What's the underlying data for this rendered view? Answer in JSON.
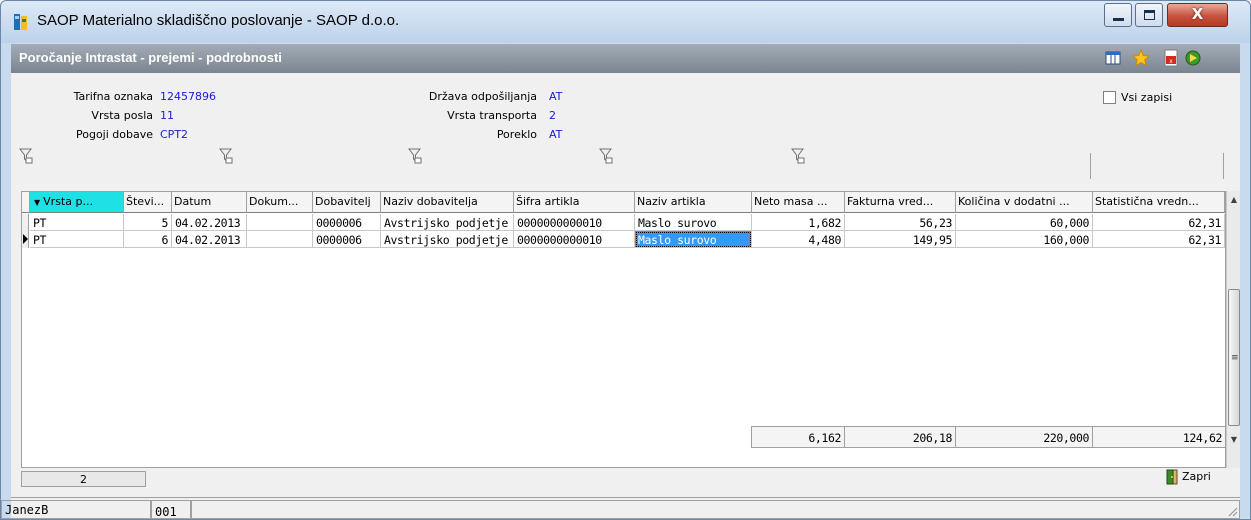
{
  "window": {
    "title": "SAOP Materialno skladiščno poslovanje - SAOP d.o.o.",
    "minimize": "—",
    "maximize": "□",
    "close": "X"
  },
  "form": {
    "title": "Poročanje Intrastat - prejemi - podrobnosti",
    "toolbar_icons": [
      "columns-icon",
      "favorite-star-icon",
      "export-pdf-icon",
      "exit-icon"
    ]
  },
  "filters": {
    "tarifna_oznaka_label": "Tarifna oznaka",
    "tarifna_oznaka": "12457896",
    "vrsta_posla_label": "Vrsta posla",
    "vrsta_posla": "11",
    "pogoji_dobave_label": "Pogoji dobave",
    "pogoji_dobave": "CPT2",
    "drzava_label": "Država odpošiljanja",
    "drzava": "AT",
    "vrsta_transporta_label": "Vrsta transporta",
    "vrsta_transporta": "2",
    "poreklo_label": "Poreklo",
    "poreklo": "AT",
    "vsi_zapisi_label": "Vsi zapisi",
    "vsi_zapisi_checked": false
  },
  "grid": {
    "columns": [
      "Vrsta p...",
      "Števi...",
      "Datum",
      "Dokum...",
      "Dobavitelj",
      "Naziv dobavitelja",
      "Šifra artikla",
      "Naziv artikla",
      "Neto masa ...",
      "Fakturna vred...",
      "Količina v dodatni ...",
      "Statistična vredn..."
    ],
    "sorted_column": 0,
    "rows": [
      [
        "PT",
        "5",
        "04.02.2013",
        "",
        "0000006",
        "Avstrijsko podjetje",
        "0000000000010",
        "Maslo surovo",
        "1,682",
        "56,23",
        "60,000",
        "62,31"
      ],
      [
        "PT",
        "6",
        "04.02.2013",
        "",
        "0000006",
        "Avstrijsko podjetje",
        "0000000000010",
        "Maslo surovo",
        "4,480",
        "149,95",
        "160,000",
        "62,31"
      ]
    ],
    "current_row": 1,
    "selected_cell": "Maslo surovo",
    "totals": {
      "neto_masa": "6,162",
      "fakturna_vrednost": "206,18",
      "kolicina": "220,000",
      "statisticna_vrednost": "124,62"
    }
  },
  "footer": {
    "record_count": "2",
    "close_label": "Zapri"
  },
  "statusbar": {
    "user": "JanezB",
    "code": "001"
  },
  "colors": {
    "sorted_header": "#1fe0e4",
    "selection": "#3399ff",
    "value_text": "#1b1bd6",
    "form_title_bg": "#8a939d"
  }
}
